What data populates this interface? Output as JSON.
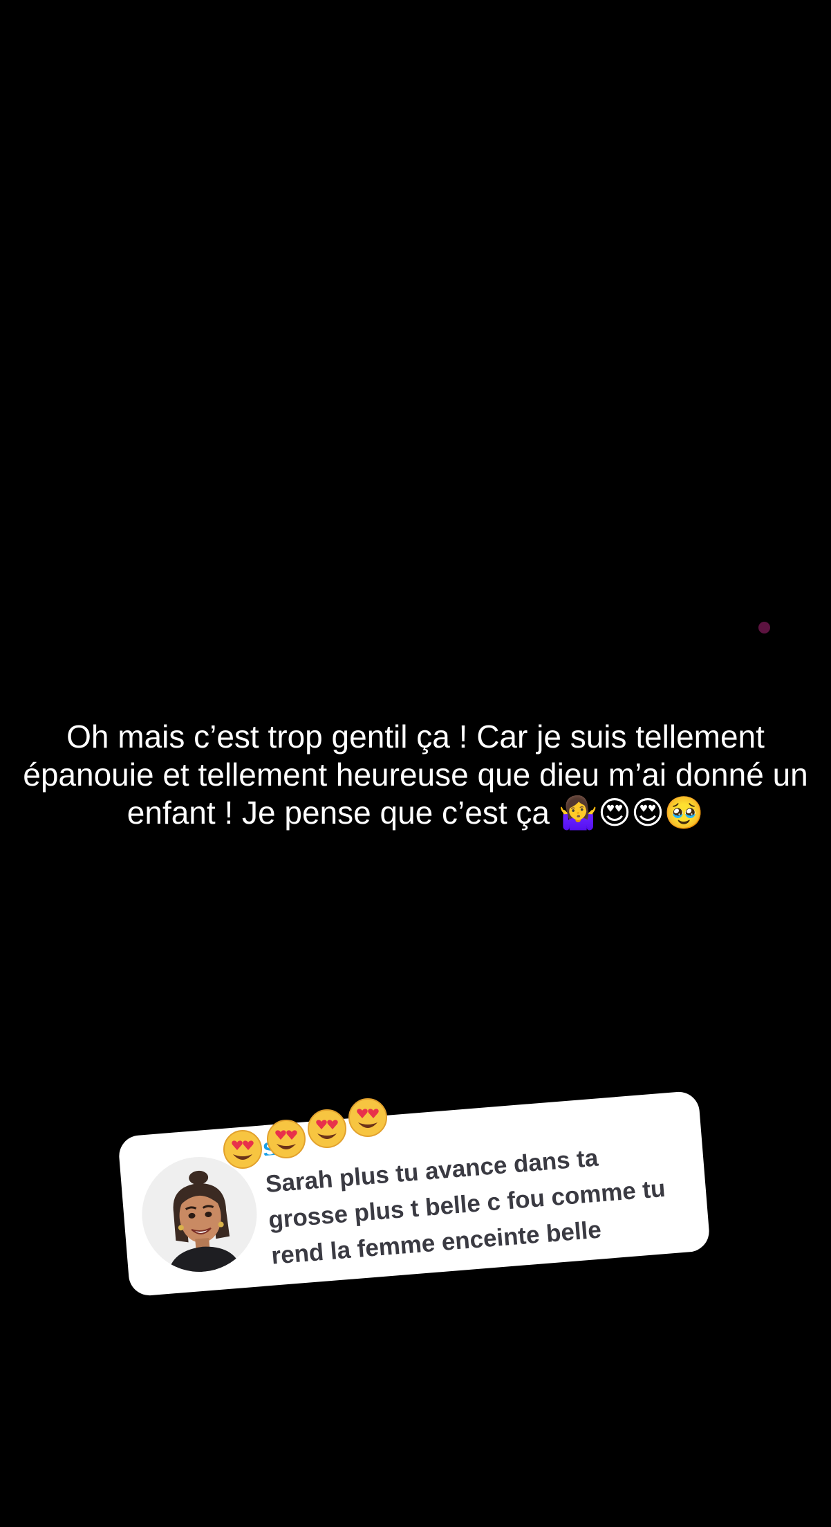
{
  "story": {
    "caption_text": "Oh mais c’est trop gentil ça ! Car je suis tellement épanouie et tellement heureuse que dieu m’ai donné un enfant ! Je pense que c’est ça",
    "caption_emojis": "🤷‍♀️😍😍🥹",
    "indicator_color": "#5c1340"
  },
  "reply_card": {
    "username": "Sarah",
    "message": "Sarah plus tu avance dans ta grosse plus t belle c fou comme tu rend la femme enceinte belle",
    "avatar_icon": "bitmoji-avatar-icon",
    "username_color": "#1aa0e8"
  },
  "stickers": {
    "emoji": "😍",
    "count": 4,
    "icon": "heart-eyes-emoji-icon"
  }
}
